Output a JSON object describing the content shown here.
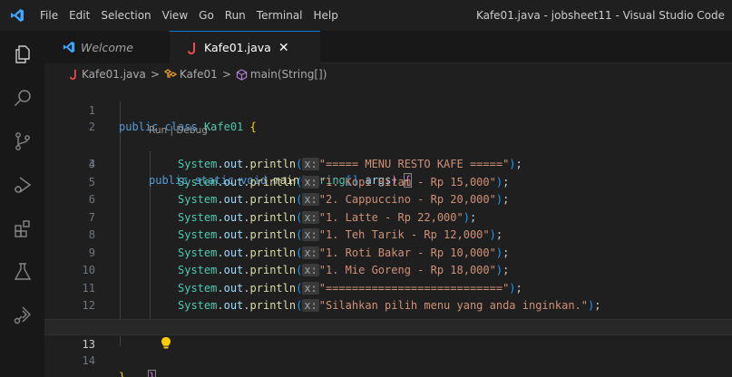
{
  "window": {
    "title": "Kafe01.java - jobsheet11 - Visual Studio Code"
  },
  "menu": [
    "File",
    "Edit",
    "Selection",
    "View",
    "Go",
    "Run",
    "Terminal",
    "Help"
  ],
  "tabs": [
    {
      "label": "Welcome",
      "icon": "vscode-icon",
      "active": false
    },
    {
      "label": "Kafe01.java",
      "icon": "java-icon",
      "active": true,
      "close": "✕"
    }
  ],
  "breadcrumb": {
    "file": "Kafe01.java",
    "class": "Kafe01",
    "method": "main(String[])",
    "separator": ">"
  },
  "codelens": "Run | Debug",
  "code": {
    "l1": {
      "num": "1",
      "kw": "public class",
      "cls": "Kafe01",
      "brace": "{"
    },
    "l2": {
      "num": "2"
    },
    "l3": {
      "num": "3",
      "kw": "public static void",
      "fn": "main",
      "cls": "String",
      "arr": "[]",
      "var": "args",
      "close": ")",
      "brace": "{"
    },
    "println": {
      "sys": "System",
      "out": "out",
      "fn": "println",
      "hint": "x:"
    },
    "prints": [
      {
        "num": "4",
        "str": "\"===== MENU RESTO KAFE =====\""
      },
      {
        "num": "5",
        "str": "\"1. Kopi Hitam - Rp 15,000\""
      },
      {
        "num": "6",
        "str": "\"2. Cappuccino - Rp 20,000\""
      },
      {
        "num": "7",
        "str": "\"1. Latte - Rp 22,000\""
      },
      {
        "num": "8",
        "str": "\"1. Teh Tarik - Rp 12,000\""
      },
      {
        "num": "9",
        "str": "\"1. Roti Bakar - Rp 10,000\""
      },
      {
        "num": "10",
        "str": "\"1. Mie Goreng - Rp 18,000\""
      },
      {
        "num": "11",
        "str": "\"===========================\""
      },
      {
        "num": "12",
        "str": "\"Silahkan pilih menu yang anda inginkan.\""
      }
    ],
    "l13": {
      "num": "13",
      "brace": "}"
    },
    "l14": {
      "num": "14",
      "brace": "}"
    }
  },
  "colors": {
    "accent": "#0078d4",
    "keyword": "#569cd6",
    "string": "#ce9178",
    "function": "#dcdcaa",
    "type": "#4ec9b0"
  }
}
